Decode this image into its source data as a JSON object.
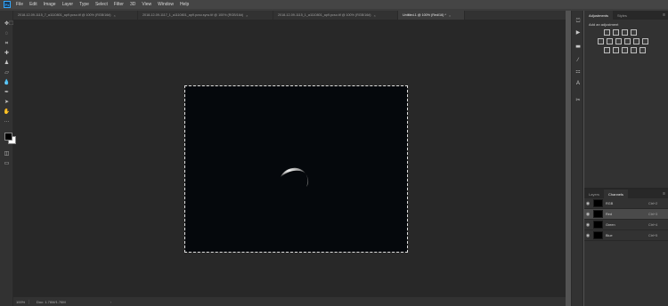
{
  "menubar": {
    "logo": "Ps",
    "items": [
      "File",
      "Edit",
      "Image",
      "Layer",
      "Type",
      "Select",
      "Filter",
      "3D",
      "View",
      "Window",
      "Help"
    ]
  },
  "document_tabs": [
    {
      "label": "2018-12-09-1115_7_a1110801_ap9.pcso.tif @ 100% (RGB/16#)",
      "active": false
    },
    {
      "label": "2018-12-09-1117_1_a1110801_ap9.pcso.sync.tif @ 100% (RGB/16#)",
      "active": false
    },
    {
      "label": "2018-12-09-1115_1_a1110801_ap9.pcso.tif @ 100% (RGB/16#)",
      "active": false
    },
    {
      "label": "Untitled-1 @ 100% (Red/16) *",
      "active": true
    }
  ],
  "status": {
    "zoom": "100%",
    "doc": "Doc: 1.76M/1.76M",
    "arrow": "›"
  },
  "adjustments": {
    "tabs": [
      "Adjustments",
      "Styles"
    ],
    "active_tab": "Adjustments",
    "title": "Add an adjustment"
  },
  "channels_panel": {
    "tabs": [
      "Layers",
      "Channels"
    ],
    "active_tab": "Channels",
    "rows": [
      {
        "name": "RGB",
        "shortcut": "Ctrl+2",
        "selected": false
      },
      {
        "name": "Red",
        "shortcut": "Ctrl+3",
        "selected": true
      },
      {
        "name": "Green",
        "shortcut": "Ctrl+4",
        "selected": false
      },
      {
        "name": "Blue",
        "shortcut": "Ctrl+5",
        "selected": false
      }
    ]
  },
  "colors": {
    "foreground": "#000000",
    "background": "#ffffff",
    "accent": "#31a8ff"
  }
}
